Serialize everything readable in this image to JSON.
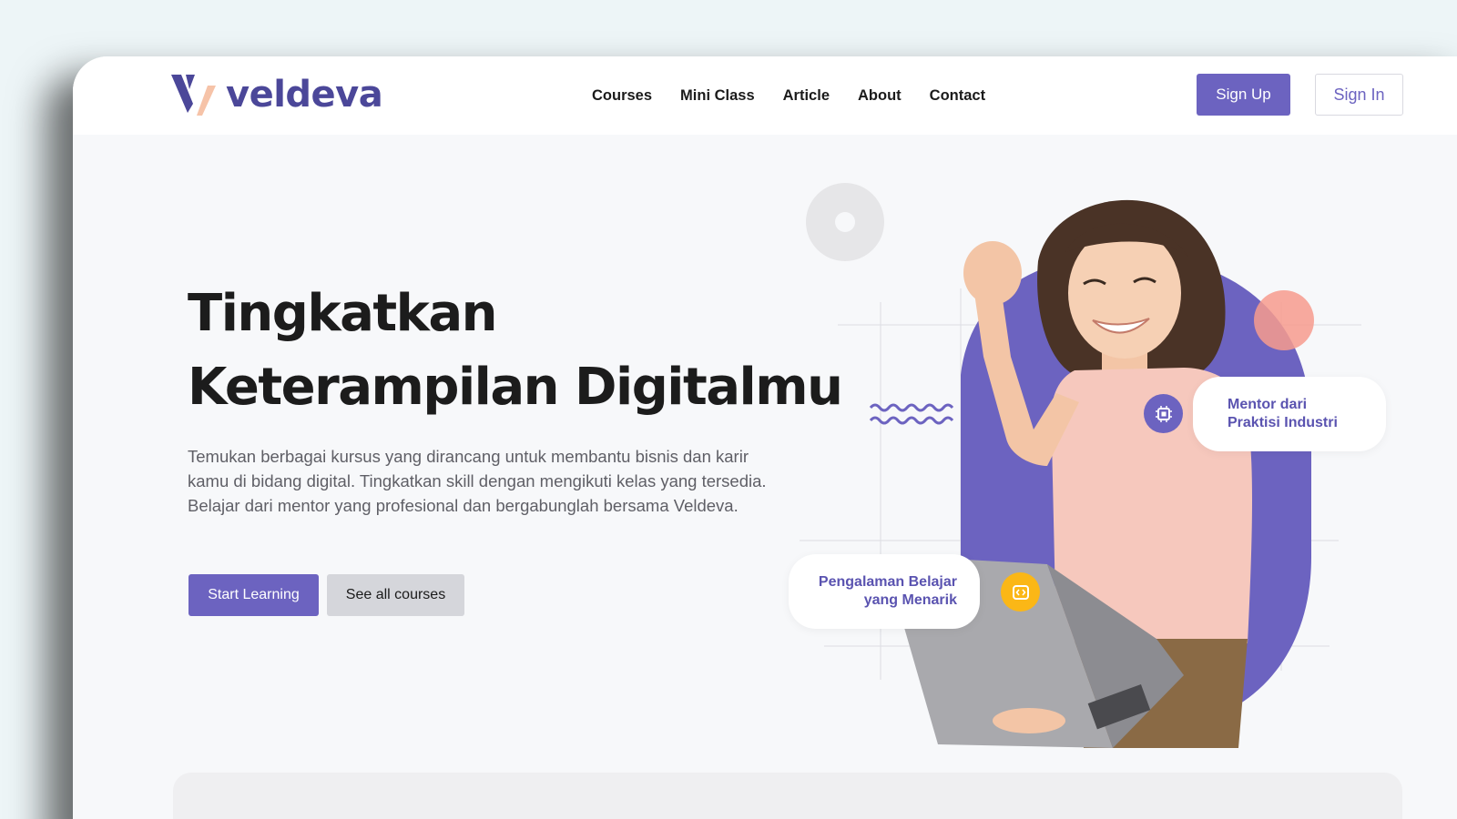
{
  "brand": {
    "name": "veldeva",
    "accent": "#6c63c0",
    "logo_orange": "#f6c3a8"
  },
  "nav": {
    "items": [
      {
        "label": "Courses"
      },
      {
        "label": "Mini Class"
      },
      {
        "label": "Article"
      },
      {
        "label": "About"
      },
      {
        "label": "Contact"
      }
    ],
    "signup_label": "Sign Up",
    "signin_label": "Sign In"
  },
  "hero": {
    "title_line1": "Tingkatkan",
    "title_line2": "Keterampilan Digitalmu",
    "description": "Temukan berbagai kursus yang dirancang untuk membantu bisnis dan karir kamu di bidang digital. Tingkatkan skill dengan mengikuti kelas yang tersedia. Belajar dari mentor yang profesional dan bergabunglah bersama Veldeva.",
    "primary_cta": "Start Learning",
    "secondary_cta": "See all courses"
  },
  "features": {
    "mentor_line1": "Mentor dari",
    "mentor_line2": "Praktisi Industri",
    "experience_line1": "Pengalaman Belajar",
    "experience_line2": "yang Menarik",
    "chip_icon": "chip-icon",
    "code_icon": "code-icon"
  },
  "colors": {
    "blob": "#6c63c0",
    "coral": "#f79b8d",
    "yellow": "#fbb716"
  }
}
